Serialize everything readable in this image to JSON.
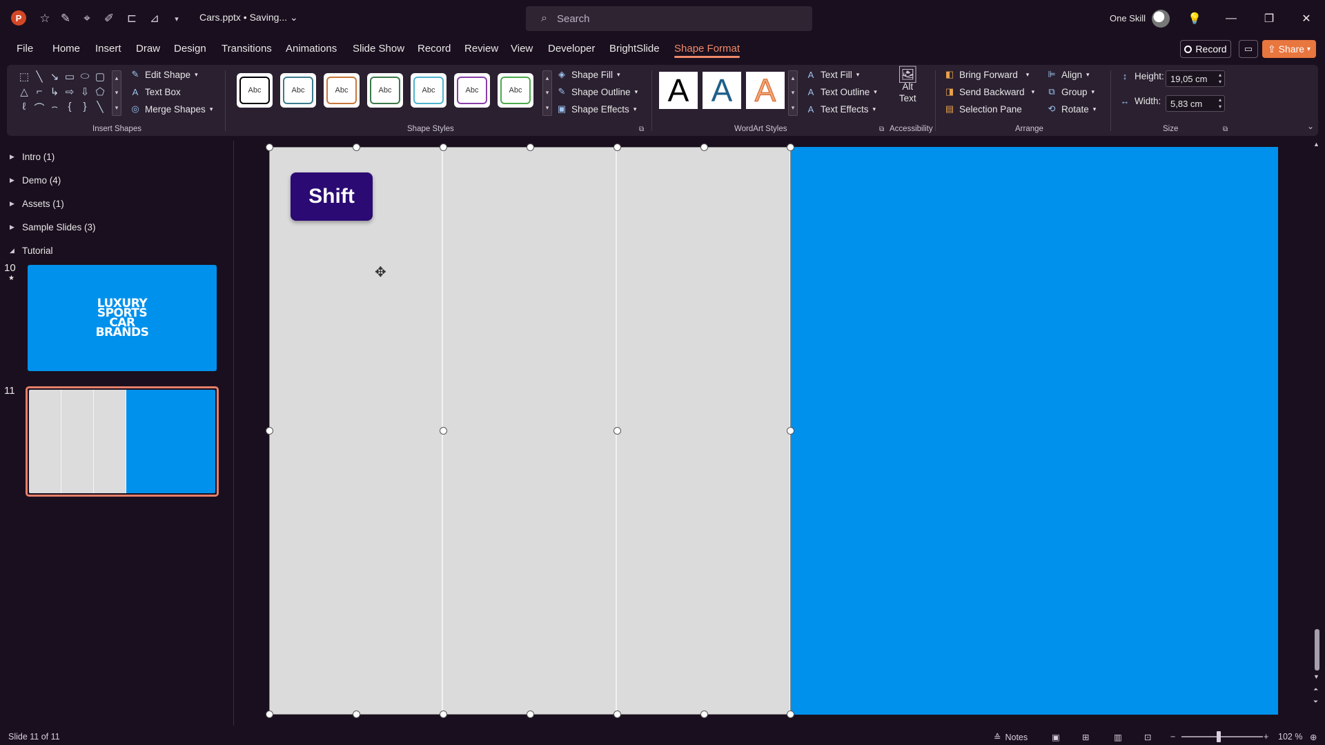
{
  "titlebar": {
    "app_logo": "P",
    "document_title": "Cars.pptx • Saving...",
    "search_placeholder": "Search",
    "user_name": "One Skill",
    "quick_access_icons": [
      "autosave-icon",
      "pen-icon",
      "target-icon",
      "shapes-icon",
      "align-icon",
      "crop-icon",
      "customize-icon"
    ]
  },
  "tabs": [
    "File",
    "Home",
    "Insert",
    "Draw",
    "Design",
    "Transitions",
    "Animations",
    "Slide Show",
    "Record",
    "Review",
    "View",
    "Developer",
    "BrightSlide",
    "Shape Format"
  ],
  "active_tab": "Shape Format",
  "top_actions": {
    "record": "Record",
    "share": "Share"
  },
  "ribbon": {
    "insert_shapes": {
      "label": "Insert Shapes",
      "edit_shape": "Edit Shape",
      "text_box": "Text Box",
      "merge_shapes": "Merge Shapes"
    },
    "shape_styles": {
      "label": "Shape Styles",
      "presets": [
        {
          "text": "Abc",
          "border": "#000000"
        },
        {
          "text": "Abc",
          "border": "#3c7c8e"
        },
        {
          "text": "Abc",
          "border": "#c8773a"
        },
        {
          "text": "Abc",
          "border": "#3a7a4a"
        },
        {
          "text": "Abc",
          "border": "#4fb3d0"
        },
        {
          "text": "Abc",
          "border": "#8a3ea8"
        },
        {
          "text": "Abc",
          "border": "#4caa4c"
        }
      ],
      "shape_fill": "Shape Fill",
      "shape_outline": "Shape Outline",
      "shape_effects": "Shape Effects"
    },
    "wordart_styles": {
      "label": "WordArt Styles",
      "presets": [
        "A",
        "A",
        "A"
      ],
      "text_fill": "Text Fill",
      "text_outline": "Text Outline",
      "text_effects": "Text Effects"
    },
    "accessibility": {
      "label": "Accessibility",
      "alt_text_line1": "Alt",
      "alt_text_line2": "Text"
    },
    "arrange": {
      "label": "Arrange",
      "bring_forward": "Bring Forward",
      "send_backward": "Send Backward",
      "selection_pane": "Selection Pane",
      "align": "Align",
      "group": "Group",
      "rotate": "Rotate"
    },
    "size": {
      "label": "Size",
      "height_label": "Height:",
      "height_value": "19,05 cm",
      "width_label": "Width:",
      "width_value": "5,83 cm"
    }
  },
  "slides_panel": {
    "sections": [
      {
        "name": "Intro (1)",
        "expanded": false
      },
      {
        "name": "Demo (4)",
        "expanded": false
      },
      {
        "name": "Assets (1)",
        "expanded": false
      },
      {
        "name": "Sample Slides (3)",
        "expanded": false
      },
      {
        "name": "Tutorial",
        "expanded": true
      }
    ],
    "slide10": {
      "number": "10",
      "title_lines": [
        "LUXURY",
        "SPORTS",
        "CAR",
        "BRANDS"
      ]
    },
    "slide11": {
      "number": "11"
    }
  },
  "slide": {
    "shift_button": "Shift",
    "background": "#0091ed",
    "panel_color": "#dbdbdb"
  },
  "statusbar": {
    "slide_info": "Slide 11 of 11",
    "notes": "Notes",
    "zoom": "102 %"
  }
}
